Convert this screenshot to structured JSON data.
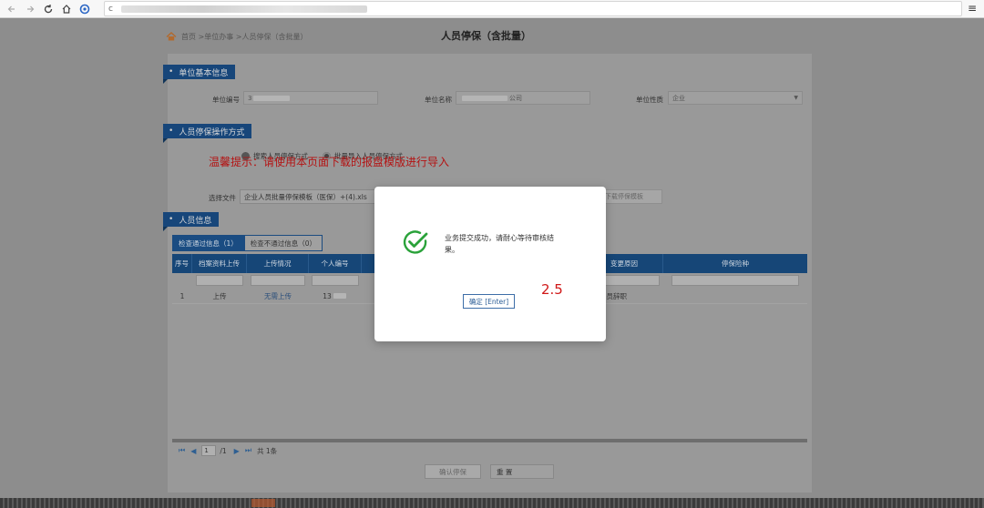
{
  "browser": {
    "address_prefix": "c"
  },
  "page": {
    "breadcrumb": "首页 >单位办事 >人员停保（含批量）",
    "title": "人员停保（含批量）"
  },
  "sections": {
    "basic_info": "单位基本信息",
    "operation": "人员停保操作方式",
    "personnel": "人员信息"
  },
  "basic_info": {
    "unit_no_label": "单位编号",
    "unit_no_value": "3",
    "unit_name_label": "单位名称",
    "unit_name_value_prefix": "",
    "unit_name_value_suffix": "公司",
    "unit_type_label": "单位性质",
    "unit_type_value": "企业"
  },
  "operation": {
    "option_single": "搜索人员停保方式",
    "option_batch": "批量导入人员停保方式",
    "warning": "温馨提示：请使用本页面下载的报盘模版进行导入",
    "file_label": "选择文件",
    "file_value": "企业人员批量停保模板（医保）+(4).xls",
    "template_button": "下载停保模板"
  },
  "tabs": [
    {
      "label": "检查通过信息（1）"
    },
    {
      "label": "检查不通过信息（0）"
    }
  ],
  "grid": {
    "columns": [
      "序号",
      "档案资料上传",
      "上传情况",
      "个人编号",
      "",
      "变更原因",
      "停保险种"
    ],
    "rows": [
      {
        "seq": "1",
        "upload": "上传",
        "status": "无需上传",
        "person_no": "13",
        "name": "",
        "reason": "在职人员辞职",
        "insurance": ""
      }
    ]
  },
  "pager": {
    "first": "⏮",
    "prev": "◀",
    "page": "1",
    "total_pages": "/1",
    "next": "▶",
    "last": "⏭",
    "total": "共 1条"
  },
  "buttons": {
    "submit": "确认停保",
    "reset": "重 置"
  },
  "modal": {
    "message": "业务提交成功，请耐心等待审核结果。",
    "confirm": "确定 [Enter]",
    "annotation": "2.5"
  },
  "colors": {
    "header_blue": "#17467a",
    "warning_red": "#b41313",
    "success_green": "#2aa23a"
  }
}
